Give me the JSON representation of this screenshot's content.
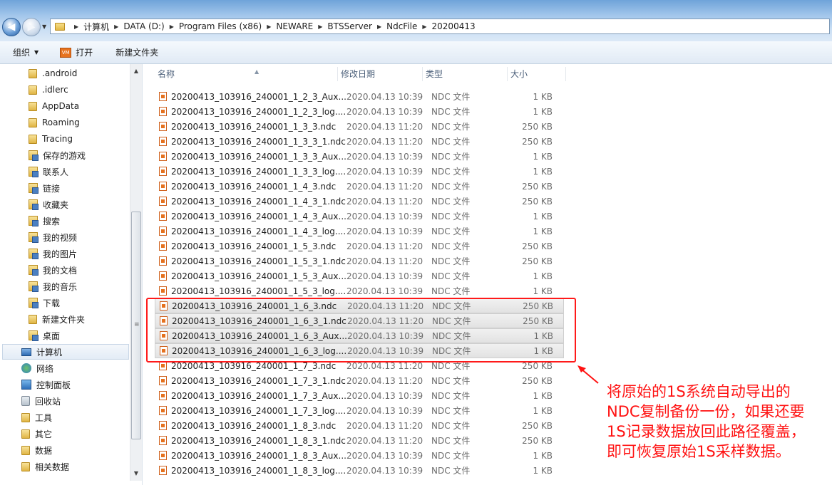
{
  "address": {
    "crumbs": [
      "计算机",
      "DATA (D:)",
      "Program Files (x86)",
      "NEWARE",
      "BTSServer",
      "NdcFile",
      "20200413"
    ]
  },
  "toolbar": {
    "organize_label": "组织",
    "open_label": "打开",
    "new_folder_label": "新建文件夹"
  },
  "nav": {
    "items": [
      {
        "label": ".android",
        "icon": "folder"
      },
      {
        "label": ".idlerc",
        "icon": "folder"
      },
      {
        "label": "AppData",
        "icon": "folder"
      },
      {
        "label": "Roaming",
        "icon": "folder"
      },
      {
        "label": "Tracing",
        "icon": "folder"
      },
      {
        "label": "保存的游戏",
        "icon": "special-folder"
      },
      {
        "label": "联系人",
        "icon": "special-folder"
      },
      {
        "label": "链接",
        "icon": "special-folder"
      },
      {
        "label": "收藏夹",
        "icon": "special-folder"
      },
      {
        "label": "搜索",
        "icon": "special-folder"
      },
      {
        "label": "我的视频",
        "icon": "special-folder"
      },
      {
        "label": "我的图片",
        "icon": "special-folder"
      },
      {
        "label": "我的文档",
        "icon": "special-folder"
      },
      {
        "label": "我的音乐",
        "icon": "special-folder"
      },
      {
        "label": "下载",
        "icon": "special-folder"
      },
      {
        "label": "新建文件夹",
        "icon": "folder"
      },
      {
        "label": "桌面",
        "icon": "special-folder"
      },
      {
        "label": "计算机",
        "icon": "computer"
      },
      {
        "label": "网络",
        "icon": "network"
      },
      {
        "label": "控制面板",
        "icon": "control-panel"
      },
      {
        "label": "回收站",
        "icon": "recycle-bin"
      },
      {
        "label": "工具",
        "icon": "folder"
      },
      {
        "label": "其它",
        "icon": "folder"
      },
      {
        "label": "数据",
        "icon": "folder"
      },
      {
        "label": "相关数据",
        "icon": "folder"
      }
    ],
    "selected": "计算机"
  },
  "columns": {
    "name": "名称",
    "date": "修改日期",
    "type": "类型",
    "size": "大小"
  },
  "files": [
    {
      "name": "20200413_103916_240001_1_2_3_Aux...",
      "date": "2020.04.13 10:39",
      "type": "NDC 文件",
      "size": "1 KB"
    },
    {
      "name": "20200413_103916_240001_1_2_3_log....",
      "date": "2020.04.13 10:39",
      "type": "NDC 文件",
      "size": "1 KB"
    },
    {
      "name": "20200413_103916_240001_1_3_3.ndc",
      "date": "2020.04.13 11:20",
      "type": "NDC 文件",
      "size": "250 KB"
    },
    {
      "name": "20200413_103916_240001_1_3_3_1.ndc",
      "date": "2020.04.13 11:20",
      "type": "NDC 文件",
      "size": "250 KB"
    },
    {
      "name": "20200413_103916_240001_1_3_3_Aux...",
      "date": "2020.04.13 10:39",
      "type": "NDC 文件",
      "size": "1 KB"
    },
    {
      "name": "20200413_103916_240001_1_3_3_log....",
      "date": "2020.04.13 10:39",
      "type": "NDC 文件",
      "size": "1 KB"
    },
    {
      "name": "20200413_103916_240001_1_4_3.ndc",
      "date": "2020.04.13 11:20",
      "type": "NDC 文件",
      "size": "250 KB"
    },
    {
      "name": "20200413_103916_240001_1_4_3_1.ndc",
      "date": "2020.04.13 11:20",
      "type": "NDC 文件",
      "size": "250 KB"
    },
    {
      "name": "20200413_103916_240001_1_4_3_Aux...",
      "date": "2020.04.13 10:39",
      "type": "NDC 文件",
      "size": "1 KB"
    },
    {
      "name": "20200413_103916_240001_1_4_3_log....",
      "date": "2020.04.13 10:39",
      "type": "NDC 文件",
      "size": "1 KB"
    },
    {
      "name": "20200413_103916_240001_1_5_3.ndc",
      "date": "2020.04.13 11:20",
      "type": "NDC 文件",
      "size": "250 KB"
    },
    {
      "name": "20200413_103916_240001_1_5_3_1.ndc",
      "date": "2020.04.13 11:20",
      "type": "NDC 文件",
      "size": "250 KB"
    },
    {
      "name": "20200413_103916_240001_1_5_3_Aux...",
      "date": "2020.04.13 10:39",
      "type": "NDC 文件",
      "size": "1 KB"
    },
    {
      "name": "20200413_103916_240001_1_5_3_log....",
      "date": "2020.04.13 10:39",
      "type": "NDC 文件",
      "size": "1 KB"
    },
    {
      "name": "20200413_103916_240001_1_6_3.ndc",
      "date": "2020.04.13 11:20",
      "type": "NDC 文件",
      "size": "250 KB",
      "highlighted": true
    },
    {
      "name": "20200413_103916_240001_1_6_3_1.ndc",
      "date": "2020.04.13 11:20",
      "type": "NDC 文件",
      "size": "250 KB",
      "highlighted": true
    },
    {
      "name": "20200413_103916_240001_1_6_3_Aux...",
      "date": "2020.04.13 10:39",
      "type": "NDC 文件",
      "size": "1 KB",
      "highlighted": true
    },
    {
      "name": "20200413_103916_240001_1_6_3_log....",
      "date": "2020.04.13 10:39",
      "type": "NDC 文件",
      "size": "1 KB",
      "highlighted": true
    },
    {
      "name": "20200413_103916_240001_1_7_3.ndc",
      "date": "2020.04.13 11:20",
      "type": "NDC 文件",
      "size": "250 KB"
    },
    {
      "name": "20200413_103916_240001_1_7_3_1.ndc",
      "date": "2020.04.13 11:20",
      "type": "NDC 文件",
      "size": "250 KB"
    },
    {
      "name": "20200413_103916_240001_1_7_3_Aux...",
      "date": "2020.04.13 10:39",
      "type": "NDC 文件",
      "size": "1 KB"
    },
    {
      "name": "20200413_103916_240001_1_7_3_log....",
      "date": "2020.04.13 10:39",
      "type": "NDC 文件",
      "size": "1 KB"
    },
    {
      "name": "20200413_103916_240001_1_8_3.ndc",
      "date": "2020.04.13 11:20",
      "type": "NDC 文件",
      "size": "250 KB"
    },
    {
      "name": "20200413_103916_240001_1_8_3_1.ndc",
      "date": "2020.04.13 11:20",
      "type": "NDC 文件",
      "size": "250 KB"
    },
    {
      "name": "20200413_103916_240001_1_8_3_Aux...",
      "date": "2020.04.13 10:39",
      "type": "NDC 文件",
      "size": "1 KB"
    },
    {
      "name": "20200413_103916_240001_1_8_3_log....",
      "date": "2020.04.13 10:39",
      "type": "NDC 文件",
      "size": "1 KB"
    }
  ],
  "annotation": {
    "text": "将原始的1S系统自动导出的NDC复制备份一份，如果还要1S记录数据放回此路径覆盖，即可恢复原始1S采样数据。",
    "color": "#ff1212"
  }
}
